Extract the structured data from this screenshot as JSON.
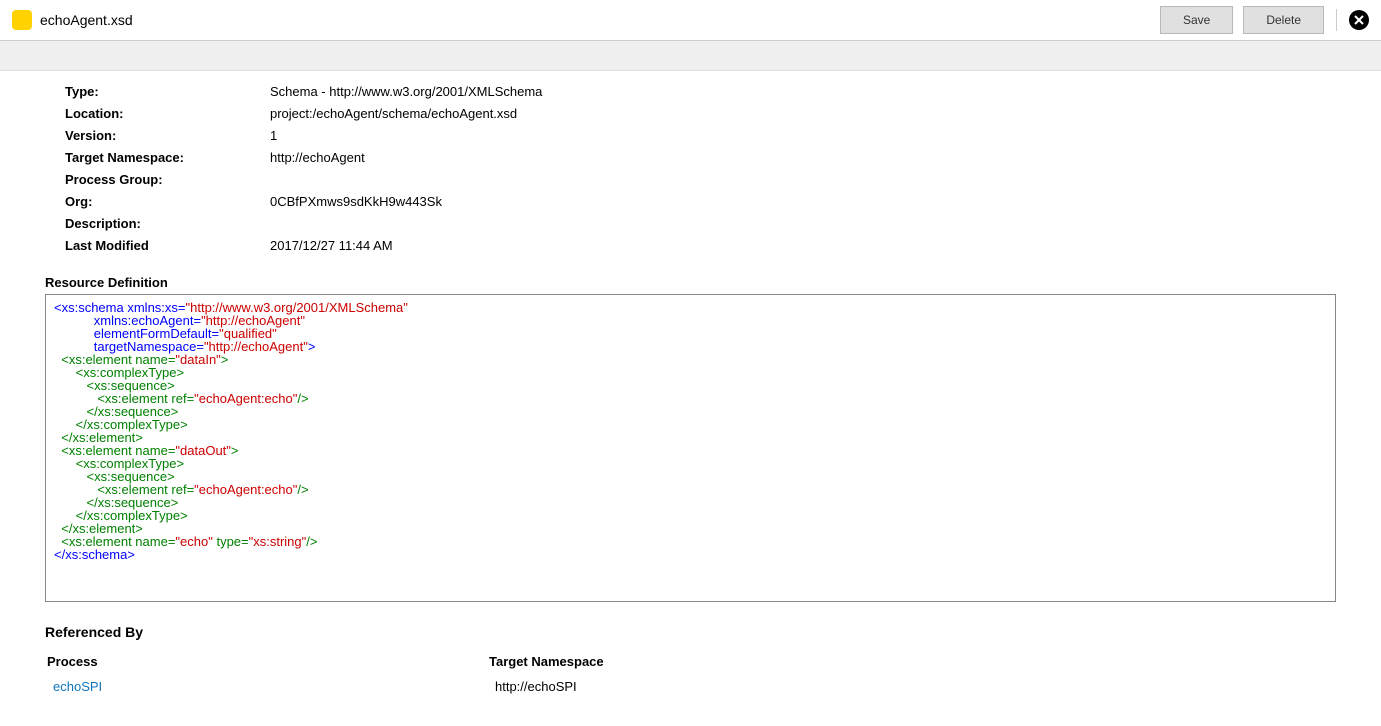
{
  "header": {
    "title": "echoAgent.xsd",
    "save_label": "Save",
    "delete_label": "Delete"
  },
  "meta": [
    {
      "label": "Type:",
      "value": "Schema - http://www.w3.org/2001/XMLSchema"
    },
    {
      "label": "Location:",
      "value": "project:/echoAgent/schema/echoAgent.xsd"
    },
    {
      "label": "Version:",
      "value": "1"
    },
    {
      "label": "Target Namespace:",
      "value": "http://echoAgent"
    },
    {
      "label": "Process Group:",
      "value": ""
    },
    {
      "label": "Org:",
      "value": "0CBfPXmws9sdKkH9w443Sk"
    },
    {
      "label": "Description:",
      "value": ""
    },
    {
      "label": "Last Modified",
      "value": "2017/12/27 11:44 AM"
    }
  ],
  "resource_def_label": "Resource Definition",
  "xml": {
    "t_schema_open_tag": "<xs:schema",
    "t_xmlnsxs": " xmlns:xs=",
    "v_xmlnsxs": "\"http://www.w3.org/2001/XMLSchema\"",
    "t_xmlnsagent": "xmlns:echoAgent=",
    "v_xmlnsagent": "\"http://echoAgent\"",
    "t_efd": "elementFormDefault=",
    "v_efd": "\"qualified\"",
    "t_tns": "targetNamespace=",
    "v_tns": "\"http://echoAgent\"",
    "close_angle": ">",
    "el_open": "<xs:element",
    "name_attr": " name=",
    "v_datain": "\"dataIn\"",
    "v_dataout": "\"dataOut\"",
    "ct_open": "<xs:complexType>",
    "seq_open": "<xs:sequence>",
    "ref_attr": " ref=",
    "v_ref": "\"echoAgent:echo\"",
    "self_close": "/>",
    "seq_close": "</xs:sequence>",
    "ct_close": "</xs:complexType>",
    "el_close": "</xs:element>",
    "v_echo": "\"echo\"",
    "type_attr": " type=",
    "v_xsstring": "\"xs:string\"",
    "schema_close": "</xs:schema>"
  },
  "referenced_by": {
    "title": "Referenced By",
    "col_process": "Process",
    "col_tns": "Target Namespace",
    "rows": [
      {
        "process": "echoSPI",
        "tns": "http://echoSPI"
      }
    ]
  }
}
